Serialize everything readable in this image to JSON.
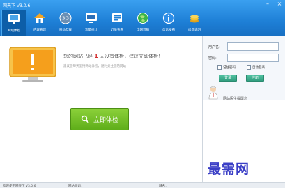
{
  "window": {
    "title": "网天下 V3.0.6",
    "minimize_icon": "minimize-icon",
    "close_icon": "close-icon"
  },
  "nav": {
    "items": [
      {
        "label": "网站体检",
        "icon": "monitor-check-icon",
        "active": true
      },
      {
        "label": "内容管理",
        "icon": "house-icon",
        "active": false
      },
      {
        "label": "移动互联",
        "icon": "3g-icon",
        "active": false
      },
      {
        "label": "流量统计",
        "icon": "display-icon",
        "active": false
      },
      {
        "label": "订单查看",
        "icon": "order-icon",
        "active": false
      },
      {
        "label": "全网营销",
        "icon": "globe-icon",
        "active": false
      },
      {
        "label": "信息发布",
        "icon": "info-icon",
        "active": false
      },
      {
        "label": "续费说明",
        "icon": "coins-icon",
        "active": false
      }
    ]
  },
  "main": {
    "message_prefix": "您的网站已经",
    "days": "1",
    "message_suffix": "天没有体检，建议立即体检！",
    "subtext": "建议您每天坚持网站体检，随时关注您的网站",
    "check_button_label": "立即体检"
  },
  "login": {
    "username_label": "用户名:",
    "username_value": "",
    "password_label": "密码:",
    "password_value": "",
    "remember_label": "记住密码",
    "auto_login_label": "自动登录",
    "login_button": "登录",
    "register_button": "注册",
    "doctor_text": "网站医生提醒您"
  },
  "watermark": "最需网",
  "status": {
    "left": "欢迎使用网天下 V3.0.6",
    "middle": "网站状态：",
    "right": "域名："
  }
}
